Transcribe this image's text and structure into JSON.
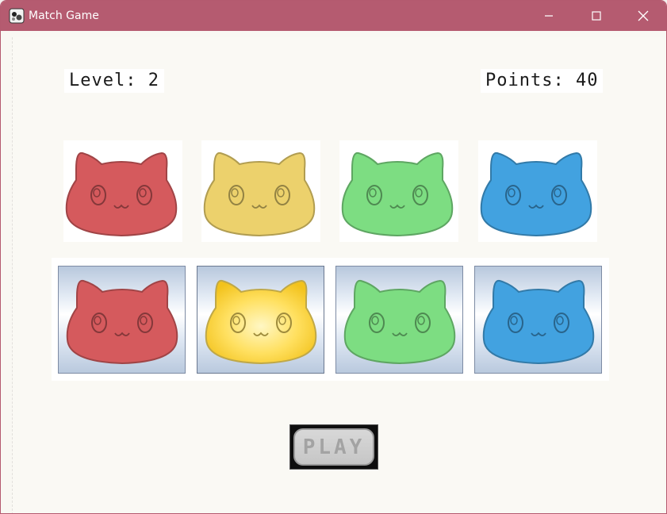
{
  "window": {
    "title": "Match Game",
    "titlebar_color": "#b55b70",
    "controls": [
      "minimize-icon",
      "maximize-icon",
      "close-icon"
    ]
  },
  "hud": {
    "level_text": "Level: 2",
    "points_text": "Points: 40"
  },
  "target_row": [
    {
      "color": "red",
      "fill": "#d55a5d"
    },
    {
      "color": "yellow",
      "fill": "#ecd16c"
    },
    {
      "color": "green",
      "fill": "#7ddd82"
    },
    {
      "color": "blue",
      "fill": "#42a2e0"
    }
  ],
  "choice_tiles": [
    {
      "color": "red",
      "fill": "#d55a5d",
      "selected": false
    },
    {
      "color": "yellow",
      "fill": "#ffe060",
      "selected": true
    },
    {
      "color": "green",
      "fill": "#7ddd82",
      "selected": false
    },
    {
      "color": "blue",
      "fill": "#42a2e0",
      "selected": false
    }
  ],
  "play_button": {
    "label": "PLAY",
    "enabled": false
  }
}
